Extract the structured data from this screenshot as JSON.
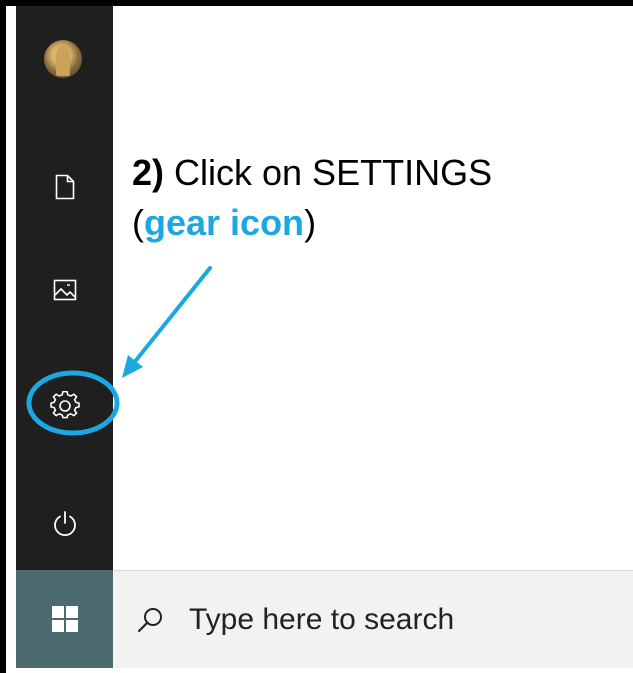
{
  "annotation": {
    "step_number": "2)",
    "line1_text": " Click on SETTINGS",
    "open_paren": "(",
    "highlight": "gear icon",
    "close_paren": ")",
    "highlight_color": "#1ba8e0"
  },
  "sidebar": {
    "items": [
      {
        "name": "user-avatar",
        "icon": "avatar"
      },
      {
        "name": "documents",
        "icon": "document-icon"
      },
      {
        "name": "pictures",
        "icon": "picture-icon"
      },
      {
        "name": "settings",
        "icon": "gear-icon"
      },
      {
        "name": "power",
        "icon": "power-icon"
      }
    ],
    "background_color": "#1f1f1f"
  },
  "taskbar": {
    "start_icon": "windows-logo-icon",
    "start_background": "#4d6a6e",
    "search": {
      "icon": "search-icon",
      "placeholder": "Type here to search"
    }
  }
}
